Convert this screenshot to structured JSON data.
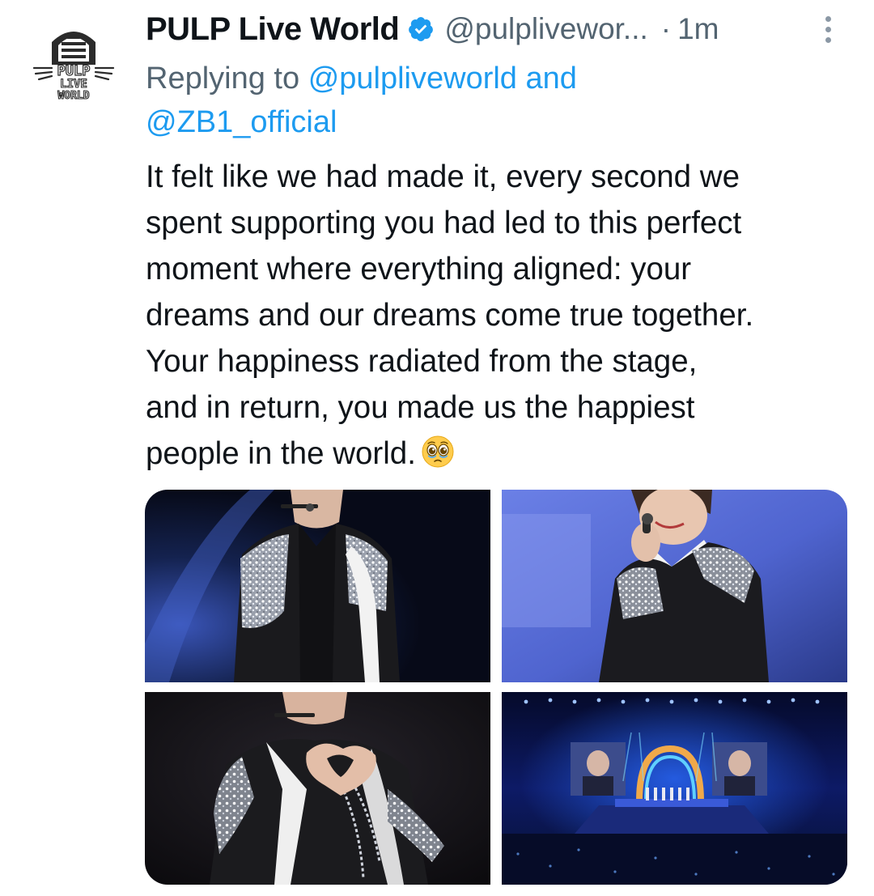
{
  "author": {
    "display_name": "PULP Live World",
    "handle": "@pulplivewor...",
    "separator": "·",
    "timestamp": "1m",
    "avatar_icon": "pulp-live-world-logo",
    "avatar_text": [
      "PULP",
      "LIVE",
      "WORLD"
    ],
    "verified_icon": "verified-badge-icon",
    "verified_color": "#1d9bf0"
  },
  "reply": {
    "prefix": "Replying to",
    "mention1": "@pulpliveworld",
    "joiner": "and",
    "mention2": "@ZB1_official"
  },
  "tweet": {
    "lines": [
      "It felt like we had made it, every second we",
      "spent supporting you had led to this perfect",
      "moment where everything aligned: your",
      "dreams and our dreams come true together.",
      "Your happiness radiated from the stage,",
      "and in return, you made us the happiest",
      "people in the world."
    ],
    "emoji": "pleading-face-with-tears-emoji"
  },
  "media": {
    "photos": [
      "performer-sparkle-jacket-headset-photo",
      "performer-singing-microphone-photo",
      "performer-heart-hands-photo",
      "concert-stage-wide-photo"
    ]
  },
  "colors": {
    "text_primary": "#0f1419",
    "text_secondary": "#536471",
    "link": "#1d9bf0",
    "background": "#ffffff"
  },
  "menu_icon": "more-vertical-icon"
}
